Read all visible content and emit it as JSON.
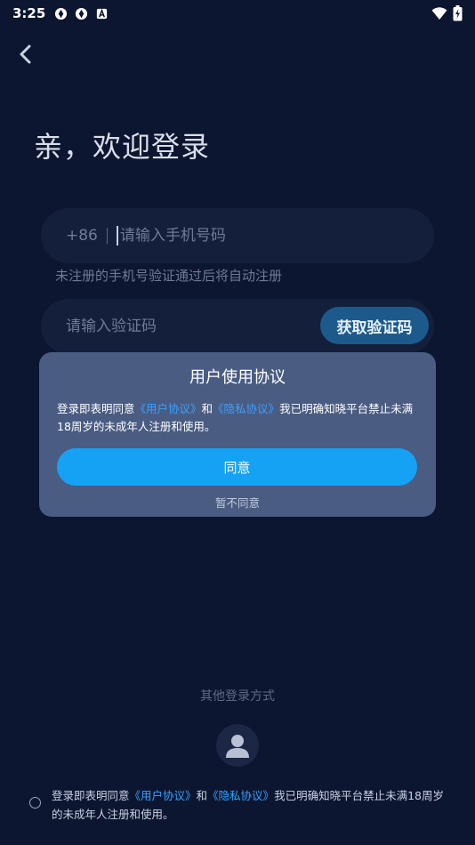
{
  "status_bar": {
    "time": "3:25",
    "icons": [
      "app-notification-icon",
      "app-notification-icon",
      "accessibility-a-icon"
    ],
    "right_icons": [
      "wifi-icon",
      "battery-charging-icon"
    ]
  },
  "header": {
    "back_icon": "chevron-left-icon",
    "title": "亲，欢迎登录"
  },
  "login_form": {
    "country_code": "+86",
    "phone_placeholder": "请输入手机号码",
    "phone_value": "",
    "hint": "未注册的手机号验证通过后将自动注册",
    "code_placeholder": "请输入验证码",
    "code_value": "",
    "get_code_label": "获取验证码"
  },
  "dialog": {
    "title": "用户使用协议",
    "text_prefix": "登录即表明同意",
    "user_agreement_link": "《用户协议》",
    "and": "和",
    "privacy_link": "《隐私协议》",
    "text_suffix": "我已明确知晓平台禁止未满18周岁的未成年人注册和使用。",
    "agree_label": "同意",
    "disagree_label": "暂不同意"
  },
  "other_login": {
    "label": "其他登录方式",
    "avatar_icon": "user-avatar-icon"
  },
  "footer": {
    "text_prefix": "登录即表明同意",
    "user_agreement_link": "《用户协议》",
    "and": "和",
    "privacy_link": "《隐私协议》",
    "text_suffix": "我已明确知晓平台禁止未满18周岁的未成年人注册和使用。",
    "checked": false
  },
  "colors": {
    "background": "#0c1630",
    "field": "#141f3c",
    "dialog": "#4a5c82",
    "accent": "#16a2f4",
    "link": "#3aa0ff"
  }
}
